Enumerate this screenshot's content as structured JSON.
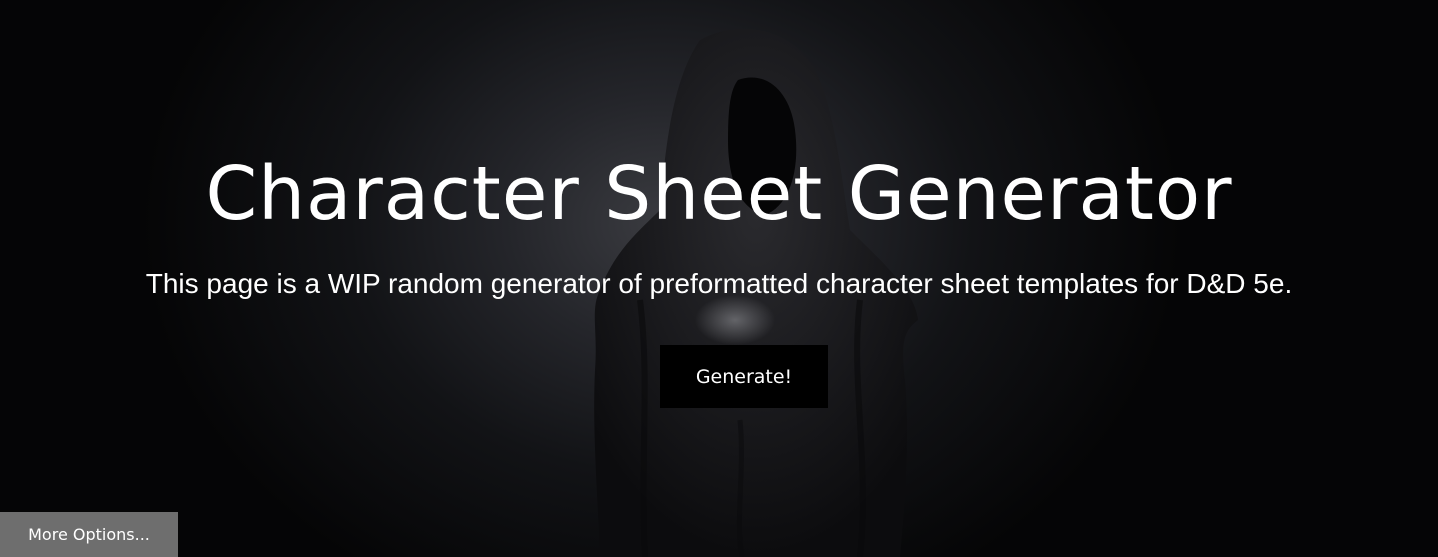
{
  "hero": {
    "title": "Character Sheet Generator",
    "subtitle": "This page is a WIP random generator of preformatted character sheet templates for D&D 5e.",
    "generate_label": "Generate!",
    "background_image": "hooded-figure-image"
  },
  "footer": {
    "more_options_label": "More Options..."
  },
  "colors": {
    "text": "#ffffff",
    "button_bg": "#000000",
    "more_options_bg": "#6e6e6e"
  }
}
